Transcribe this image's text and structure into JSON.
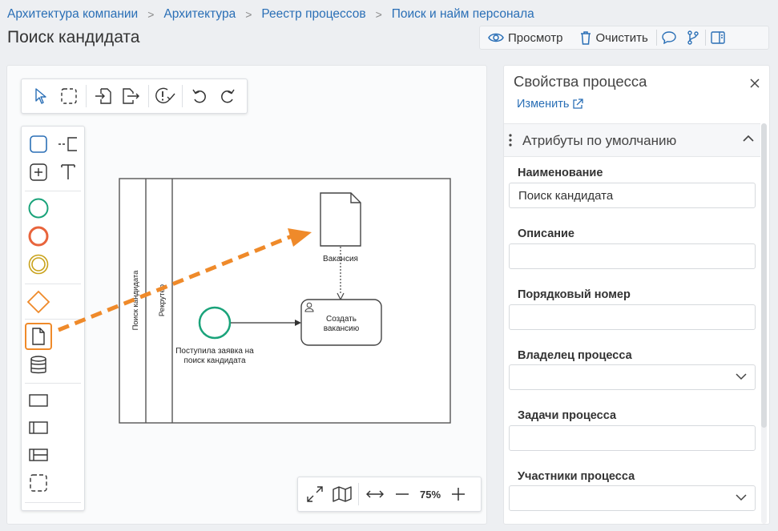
{
  "breadcrumb": [
    "Архитектура компании",
    "Архитектура",
    "Реестр процессов",
    "Поиск и найм персонала"
  ],
  "page_title": "Поиск кандидата",
  "top_toolbar": {
    "view_label": "Просмотр",
    "clear_label": "Очистить"
  },
  "diagram": {
    "pool_label": "Поиск кандидата",
    "lane_label": "Рекрутёр",
    "start_event_label_line1": "Поступила заявка на",
    "start_event_label_line2": "поиск кандидата",
    "task_label_line1": "Создать",
    "task_label_line2": "вакансию",
    "data_object_label": "Вакансия"
  },
  "zoom": {
    "level": "75%"
  },
  "properties": {
    "title": "Свойства процесса",
    "edit_label": "Изменить",
    "section_label": "Атрибуты по умолчанию",
    "fields": {
      "name_label": "Наименование",
      "name_value": "Поиск кандидата",
      "description_label": "Описание",
      "description_value": "",
      "order_label": "Порядковый номер",
      "order_value": "",
      "owner_label": "Владелец процесса",
      "owner_value": "",
      "tasks_label": "Задачи процесса",
      "tasks_value": "",
      "participants_label": "Участники процесса",
      "participants_value": ""
    }
  },
  "colors": {
    "link": "#2a6fb6",
    "palette_blue": "#2a6fb6",
    "start_event_green": "#1aa37a",
    "end_event_orange": "#e8643c",
    "intermediate_gold": "#c9a21a",
    "gateway_orange": "#ef8a2a",
    "highlight_arrow": "#ef8a2a"
  },
  "icons": [
    "eye-icon",
    "trash-icon",
    "comment-icon",
    "branch-icon",
    "panel-icon",
    "pointer-icon",
    "lasso-icon",
    "import-icon",
    "export-icon",
    "validate-icon",
    "undo-icon",
    "redo-icon",
    "fit-screen-icon",
    "map-icon",
    "fit-width-icon",
    "zoom-out-icon",
    "zoom-in-icon",
    "close-icon",
    "external-link-icon",
    "more-icon",
    "chevron-up-icon",
    "chevron-down-icon"
  ]
}
